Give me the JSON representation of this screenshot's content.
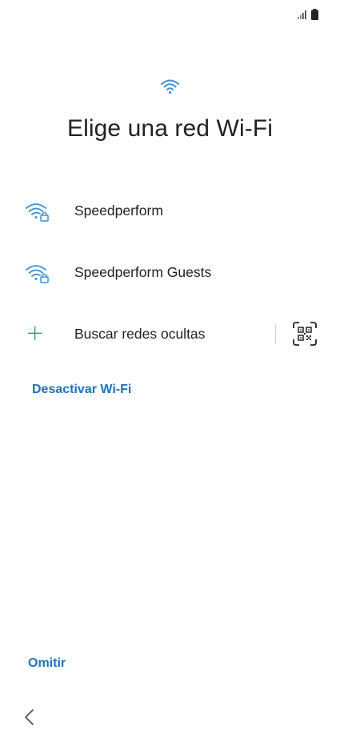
{
  "status_bar": {
    "icons": [
      "signal-icon",
      "battery-icon"
    ]
  },
  "header": {
    "icon": "wifi-icon",
    "title": "Elige una red Wi-Fi"
  },
  "networks": [
    {
      "name": "Speedperform",
      "icon": "wifi-lock-icon"
    },
    {
      "name": "Speedperform Guests",
      "icon": "wifi-lock-icon"
    }
  ],
  "hidden_networks": {
    "label": "Buscar redes ocultas",
    "icon": "plus-icon",
    "qr_icon": "qr-code-scan-icon"
  },
  "actions": {
    "disable_wifi": "Desactivar Wi-Fi",
    "skip": "Omitir"
  },
  "navigation": {
    "back_icon": "chevron-left-icon"
  },
  "colors": {
    "accent": "#1a73c9",
    "wifi_icon": "#3d8fd9",
    "plus_icon": "#2fa562",
    "text": "#222222"
  }
}
